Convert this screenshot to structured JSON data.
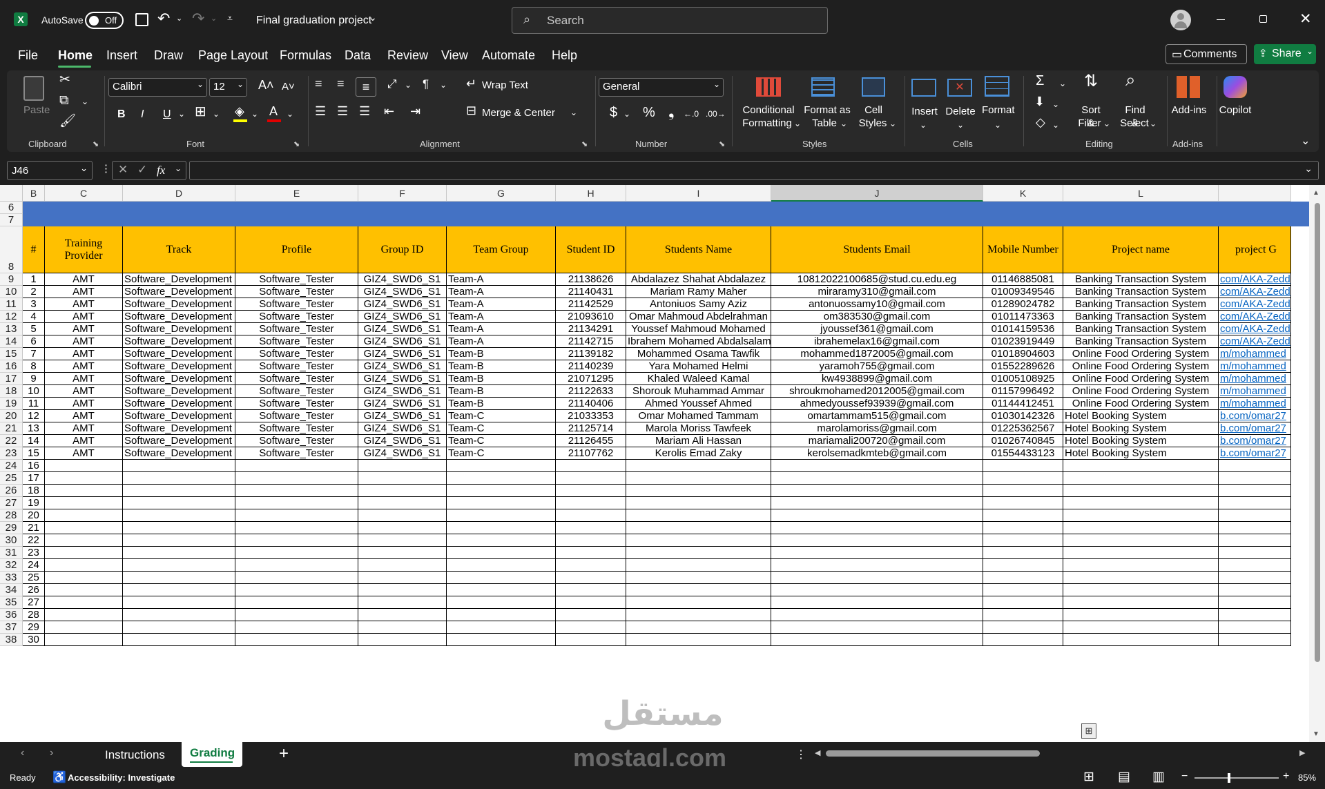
{
  "titlebar": {
    "autosave_label": "AutoSave",
    "autosave_state": "Off",
    "file_title": "Final graduation project",
    "search_placeholder": "Search"
  },
  "menu": [
    "File",
    "Home",
    "Insert",
    "Draw",
    "Page Layout",
    "Formulas",
    "Data",
    "Review",
    "View",
    "Automate",
    "Help"
  ],
  "menu_active": "Home",
  "comments_label": "Comments",
  "share_label": "Share",
  "ribbon": {
    "clipboard": {
      "paste": "Paste",
      "label": "Clipboard"
    },
    "font": {
      "name": "Calibri",
      "size": "12",
      "bold": "B",
      "italic": "I",
      "underline": "U",
      "label": "Font"
    },
    "alignment": {
      "wrap": "Wrap Text",
      "merge": "Merge & Center",
      "label": "Alignment"
    },
    "number": {
      "format": "General",
      "label": "Number"
    },
    "styles": {
      "cond1": "Conditional",
      "cond2": "Formatting",
      "fmt1": "Format as",
      "fmt2": "Table",
      "cell1": "Cell",
      "cell2": "Styles",
      "label": "Styles"
    },
    "cells": {
      "insert": "Insert",
      "delete": "Delete",
      "format": "Format",
      "label": "Cells"
    },
    "editing": {
      "sort1": "Sort &",
      "sort2": "Filter",
      "find1": "Find &",
      "find2": "Select",
      "label": "Editing"
    },
    "addins": {
      "addins": "Add-ins",
      "label": "Add-ins"
    },
    "copilot": "Copilot"
  },
  "namebox": "J46",
  "fx": "fx",
  "columns": [
    {
      "letter": "B",
      "w": 32
    },
    {
      "letter": "C",
      "w": 113
    },
    {
      "letter": "D",
      "w": 163
    },
    {
      "letter": "E",
      "w": 178
    },
    {
      "letter": "F",
      "w": 128
    },
    {
      "letter": "G",
      "w": 158
    },
    {
      "letter": "H",
      "w": 102
    },
    {
      "letter": "I",
      "w": 210
    },
    {
      "letter": "J",
      "w": 307
    },
    {
      "letter": "K",
      "w": 116
    },
    {
      "letter": "L",
      "w": 225
    },
    {
      "letter": "",
      "w": 105
    }
  ],
  "headers": [
    "#",
    "Training Provider",
    "Track",
    "Profile",
    "Group ID",
    "Team Group",
    "Student ID",
    "Students Name",
    "Students Email",
    "Mobile Number",
    "Project name",
    "project G"
  ],
  "rows": [
    [
      "1",
      "AMT",
      "Software_Development",
      "Software_Tester",
      "GIZ4_SWD6_S1",
      "Team-A",
      "21138626",
      "Abdalazez Shahat Abdalazez",
      "10812022100685@stud.cu.edu.eg",
      "01146885081",
      "Banking Transaction System",
      "com/AKA-Zedd"
    ],
    [
      "2",
      "AMT",
      "Software_Development",
      "Software_Tester",
      "GIZ4_SWD6_S1",
      "Team-A",
      "21140431",
      "Mariam Ramy Maher",
      "miraramy310@gmail.com",
      "01009349546",
      "Banking Transaction System",
      "com/AKA-Zedd"
    ],
    [
      "3",
      "AMT",
      "Software_Development",
      "Software_Tester",
      "GIZ4_SWD6_S1",
      "Team-A",
      "21142529",
      "Antoniuos Samy Aziz",
      "antonuossamy10@gmail.com",
      "01289024782",
      "Banking Transaction System",
      "com/AKA-Zedd"
    ],
    [
      "4",
      "AMT",
      "Software_Development",
      "Software_Tester",
      "GIZ4_SWD6_S1",
      "Team-A",
      "21093610",
      "Omar Mahmoud Abdelrahman",
      "om383530@gmail.com",
      "01011473363",
      "Banking Transaction System",
      "com/AKA-Zedd"
    ],
    [
      "5",
      "AMT",
      "Software_Development",
      "Software_Tester",
      "GIZ4_SWD6_S1",
      "Team-A",
      "21134291",
      "Youssef Mahmoud Mohamed",
      "jyoussef361@gmail.com",
      "01014159536",
      "Banking Transaction System",
      "com/AKA-Zedd"
    ],
    [
      "6",
      "AMT",
      "Software_Development",
      "Software_Tester",
      "GIZ4_SWD6_S1",
      "Team-A",
      "21142715",
      "Ibrahem Mohamed Abdalsalam",
      "ibrahemelax16@gmail.com",
      "01023919449",
      "Banking Transaction System",
      "com/AKA-Zedd"
    ],
    [
      "7",
      "AMT",
      "Software_Development",
      "Software_Tester",
      "GIZ4_SWD6_S1",
      "Team-B",
      "21139182",
      "Mohammed Osama Tawfik",
      "mohammed1872005@gmail.com",
      "01018904603",
      "Online Food Ordering System",
      "m/mohammed"
    ],
    [
      "8",
      "AMT",
      "Software_Development",
      "Software_Tester",
      "GIZ4_SWD6_S1",
      "Team-B",
      "21140239",
      "Yara Mohamed Helmi",
      "yaramoh755@gmail.com",
      "01552289626",
      "Online Food Ordering System",
      "m/mohammed"
    ],
    [
      "9",
      "AMT",
      "Software_Development",
      "Software_Tester",
      "GIZ4_SWD6_S1",
      "Team-B",
      "21071295",
      "Khaled Waleed Kamal",
      "kw4938899@gmail.com",
      "01005108925",
      "Online Food Ordering System",
      "m/mohammed"
    ],
    [
      "10",
      "AMT",
      "Software_Development",
      "Software_Tester",
      "GIZ4_SWD6_S1",
      "Team-B",
      "21122633",
      "Shorouk Muhammad Ammar",
      "shroukmohamed2012005@gmail.com",
      "01157996492",
      "Online Food Ordering System",
      "m/mohammed"
    ],
    [
      "11",
      "AMT",
      "Software_Development",
      "Software_Tester",
      "GIZ4_SWD6_S1",
      "Team-B",
      "21140406",
      "Ahmed Youssef Ahmed",
      "ahmedyoussef93939@gmail.com",
      "01144412451",
      "Online Food Ordering System",
      "m/mohammed"
    ],
    [
      "12",
      "AMT",
      "Software_Development",
      "Software_Tester",
      "GIZ4_SWD6_S1",
      "Team-C",
      "21033353",
      "Omar Mohamed Tammam",
      "omartammam515@gmail.com",
      "01030142326",
      "Hotel Booking System",
      "b.com/omar27"
    ],
    [
      "13",
      "AMT",
      "Software_Development",
      "Software_Tester",
      "GIZ4_SWD6_S1",
      "Team-C",
      "21125714",
      "Marola Moriss Tawfeek",
      "marolamoriss@gmail.com",
      "01225362567",
      "Hotel Booking System",
      "b.com/omar27"
    ],
    [
      "14",
      "AMT",
      "Software_Development",
      "Software_Tester",
      "GIZ4_SWD6_S1",
      "Team-C",
      "21126455",
      "Mariam Ali Hassan",
      "mariamali200720@gmail.com",
      "01026740845",
      "Hotel Booking System",
      "b.com/omar27"
    ],
    [
      "15",
      "AMT",
      "Software_Development",
      "Software_Tester",
      "GIZ4_SWD6_S1",
      "Team-C",
      "21107762",
      "Kerolis Emad Zaky",
      "kerolsemadkmteb@gmail.com",
      "01554433123",
      "Hotel Booking System",
      "b.com/omar27"
    ]
  ],
  "empty_rows": [
    [
      "24",
      "16"
    ],
    [
      "25",
      "17"
    ],
    [
      "26",
      "18"
    ],
    [
      "27",
      "19"
    ],
    [
      "28",
      "20"
    ],
    [
      "29",
      "21"
    ],
    [
      "30",
      "22"
    ],
    [
      "31",
      "23"
    ],
    [
      "32",
      "24"
    ],
    [
      "33",
      "25"
    ],
    [
      "34",
      "26"
    ],
    [
      "35",
      "27"
    ],
    [
      "36",
      "28"
    ],
    [
      "37",
      "29"
    ],
    [
      "38",
      "30"
    ]
  ],
  "header_row_numbers": [
    "6",
    "7",
    "8"
  ],
  "data_row_numbers": [
    "9",
    "10",
    "11",
    "12",
    "13",
    "14",
    "15",
    "16",
    "17",
    "18",
    "19",
    "20",
    "21",
    "22",
    "23"
  ],
  "sheets": [
    "Instructions",
    "Grading"
  ],
  "active_sheet": "Grading",
  "status": {
    "ready": "Ready",
    "accessibility": "Accessibility: Investigate",
    "zoom": "85%"
  },
  "watermark": {
    "arabic": "مستقل",
    "latin": "mostaql.com"
  },
  "colors": {
    "header_fill": "#ffc000",
    "banner_fill": "#4472c4",
    "share_green": "#107c41",
    "link": "#0563c1"
  }
}
